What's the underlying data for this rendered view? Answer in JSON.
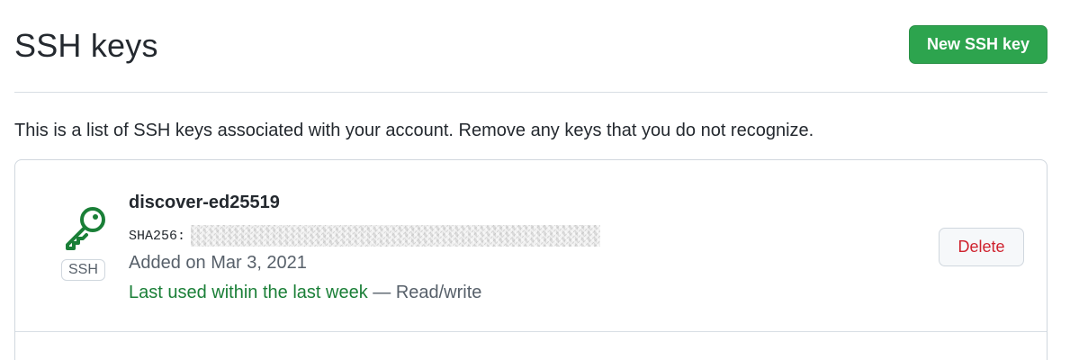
{
  "header": {
    "title": "SSH keys",
    "new_key_label": "New SSH key"
  },
  "description": "This is a list of SSH keys associated with your account. Remove any keys that you do not recognize.",
  "keys": [
    {
      "icon": "key-icon",
      "type_label": "SSH",
      "title": "discover-ed25519",
      "fingerprint_label": "SHA256:",
      "added_on": "Added on Mar 3, 2021",
      "last_used": "Last used within the last week",
      "access": " — Read/write",
      "delete_label": "Delete"
    }
  ],
  "colors": {
    "primary_button": "#2da44e",
    "danger_text": "#cf222e",
    "success_text": "#1a7f37",
    "muted_text": "#57606a"
  }
}
